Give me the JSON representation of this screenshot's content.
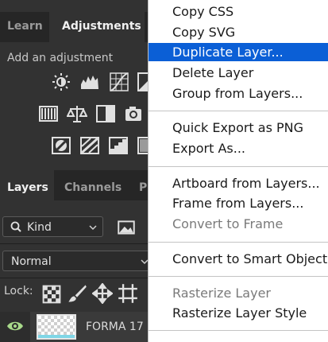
{
  "panel_tabs": {
    "learn": "Learn",
    "adjustments": "Adjustments",
    "layers": "Layers",
    "channels": "Channels",
    "paths_partial": "P"
  },
  "adjustments": {
    "caption": "Add an adjustment"
  },
  "layers": {
    "filter_kind": "Kind",
    "blend_mode": "Normal",
    "lock_label": "Lock:",
    "layer_name": "FORMA 17"
  },
  "context_menu": {
    "copy_css": "Copy CSS",
    "copy_svg": "Copy SVG",
    "duplicate_layer": "Duplicate Layer...",
    "delete_layer": "Delete Layer",
    "group_from_layers": "Group from Layers...",
    "quick_export": "Quick Export as PNG",
    "export_as": "Export As...",
    "artboard_from_layers": "Artboard from Layers...",
    "frame_from_layers": "Frame from Layers...",
    "convert_to_frame": "Convert to Frame",
    "convert_to_smart_object": "Convert to Smart Object",
    "rasterize_layer": "Rasterize Layer",
    "rasterize_layer_style": "Rasterize Layer Style"
  },
  "colors": {
    "highlight": "#0b5fd6",
    "panel": "#323232",
    "menu": "#ffffff"
  }
}
